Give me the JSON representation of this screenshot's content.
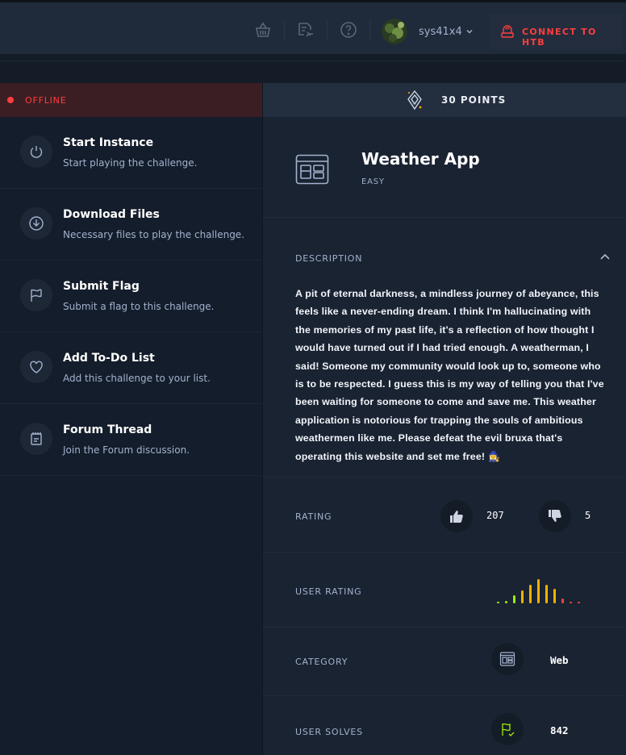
{
  "topbar": {
    "icons": [
      "basket-icon",
      "voucher-icon",
      "help-icon"
    ],
    "username": "sys41x4",
    "connect_label": "CONNECT TO HTB"
  },
  "status": {
    "label": "OFFLINE",
    "color": "#ff3e3e"
  },
  "actions": [
    {
      "title": "Start Instance",
      "subtitle": "Start playing the challenge.",
      "icon": "power-icon"
    },
    {
      "title": "Download Files",
      "subtitle": "Necessary files to play the challenge.",
      "icon": "download-icon"
    },
    {
      "title": "Submit Flag",
      "subtitle": "Submit a flag to this challenge.",
      "icon": "flag-icon"
    },
    {
      "title": "Add To-Do List",
      "subtitle": "Add this challenge to your list.",
      "icon": "heart-icon"
    },
    {
      "title": "Forum Thread",
      "subtitle": "Join the Forum discussion.",
      "icon": "forum-icon"
    }
  ],
  "challenge": {
    "points_label": "30 POINTS",
    "title": "Weather App",
    "difficulty": "EASY",
    "description_label": "DESCRIPTION",
    "description": "A pit of eternal darkness, a mindless journey of abeyance, this feels like a never-ending dream. I think I'm hallucinating with the memories of my past life, it's a reflection of how thought I would have turned out if I had tried enough. A weatherman, I said! Someone my community would look up to, someone who is to be respected. I guess this is my way of telling you that I've been waiting for someone to come and save me. This weather application is notorious for trapping the souls of ambitious weathermen like me. Please defeat the evil bruxa that's operating this website and set me free! 🧙‍♀️",
    "rating_label": "RATING",
    "likes": "207",
    "dislikes": "5",
    "user_rating_label": "USER RATING",
    "user_rating_distribution": [
      0.05,
      0.08,
      0.3,
      0.5,
      0.72,
      0.95,
      0.72,
      0.55,
      0.2,
      0.05,
      0.05
    ],
    "user_rating_colors": [
      "#9fef00",
      "#9fef00",
      "#9fef00",
      "#ffaf00",
      "#ffaf00",
      "#ffaf00",
      "#ffaf00",
      "#ffaf00",
      "#ff3e3e",
      "#ff3e3e",
      "#ff3e3e"
    ],
    "category_label": "CATEGORY",
    "category": "Web",
    "user_solves_label": "USER SOLVES",
    "user_solves": "842"
  }
}
